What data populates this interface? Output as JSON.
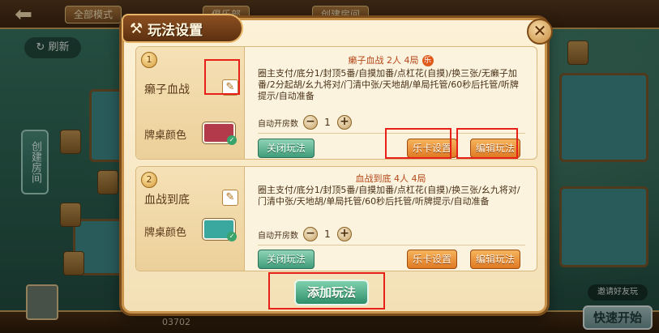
{
  "background": {
    "back_icon": "back-arrow-icon",
    "top_chips": [
      "全部模式",
      "俱乐部",
      "创建房间"
    ],
    "refresh_label": "刷新",
    "side_tab_label": "创建房间",
    "quick_start_label": "快速开始",
    "invite_label": "邀请好友玩",
    "room_num": "03702"
  },
  "dialog": {
    "title": "玩法设置",
    "title_icon": "crossed-tools-icon",
    "close_icon": "close-icon",
    "add_button_label": "添加玩法",
    "modes": [
      {
        "index": "1",
        "name": "癞子血战",
        "color_label": "牌桌颜色",
        "color": "#b23a4a",
        "header": "癞子血战  2人  4局",
        "fee_badge": "乐",
        "rules": "圈主支付/底分1/封顶5番/自摸加番/点杠花(自摸)/换三张/无癞子加番/2分起胡/幺九将对/门清中张/天地胡/单局托管/60秒后托管/听牌提示/自动准备",
        "room_count_label": "自动开房数",
        "room_count": "1",
        "close_label": "关闭玩法",
        "fun_card_label": "乐卡设置",
        "edit_label": "编辑玩法"
      },
      {
        "index": "2",
        "name": "血战到底",
        "color_label": "牌桌颜色",
        "color": "#3aa89e",
        "header": "血战到底  4人  4局",
        "rules": "圈主支付/底分1/封顶5番/自摸加番/点杠花(自摸)/换三张/幺九将对/门清中张/天地胡/单局托管/60秒后托管/听牌提示/自动准备",
        "room_count_label": "自动开房数",
        "room_count": "1",
        "close_label": "关闭玩法",
        "fun_card_label": "乐卡设置",
        "edit_label": "编辑玩法"
      }
    ]
  },
  "colors": {
    "highlight": "#e8201a",
    "accent_green": "#3f9c7a",
    "accent_orange": "#e07a24"
  }
}
